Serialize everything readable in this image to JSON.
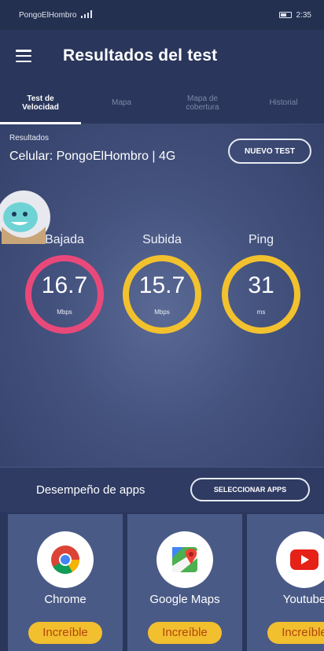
{
  "status_bar": {
    "carrier": "PongoElHombro",
    "time": "2:35"
  },
  "app_bar": {
    "title": "Resultados del test"
  },
  "tabs": [
    {
      "label_line1": "Test de",
      "label_line2": "Velocidad",
      "active": true
    },
    {
      "label_line1": "Mapa",
      "label_line2": "",
      "active": false
    },
    {
      "label_line1": "Mapa de",
      "label_line2": "cobertura",
      "active": false
    },
    {
      "label_line1": "Historial",
      "label_line2": "",
      "active": false
    }
  ],
  "results": {
    "label": "Resultados",
    "connection": "Celular: PongoElHombro | 4G",
    "new_test_button": "NUEVO TEST"
  },
  "metrics": [
    {
      "label": "Bajada",
      "value": "16.7",
      "unit": "Mbps",
      "color": "#e8497a"
    },
    {
      "label": "Subida",
      "value": "15.7",
      "unit": "Mbps",
      "color": "#f2c12e"
    },
    {
      "label": "Ping",
      "value": "31",
      "unit": "ms",
      "color": "#f2c12e"
    }
  ],
  "apps_section": {
    "title": "Desempeño de apps",
    "select_button": "SELECCIONAR APPS",
    "apps": [
      {
        "name": "Chrome",
        "rating": "Increíble",
        "icon": "chrome-icon"
      },
      {
        "name": "Google Maps",
        "rating": "Increíble",
        "icon": "google-maps-icon"
      },
      {
        "name": "Youtube",
        "rating": "Increíble",
        "icon": "youtube-icon"
      }
    ]
  },
  "colors": {
    "background": "#2f3b63",
    "download_ring": "#e8497a",
    "upload_ring": "#f2c12e",
    "badge": "#f2bf2f"
  }
}
